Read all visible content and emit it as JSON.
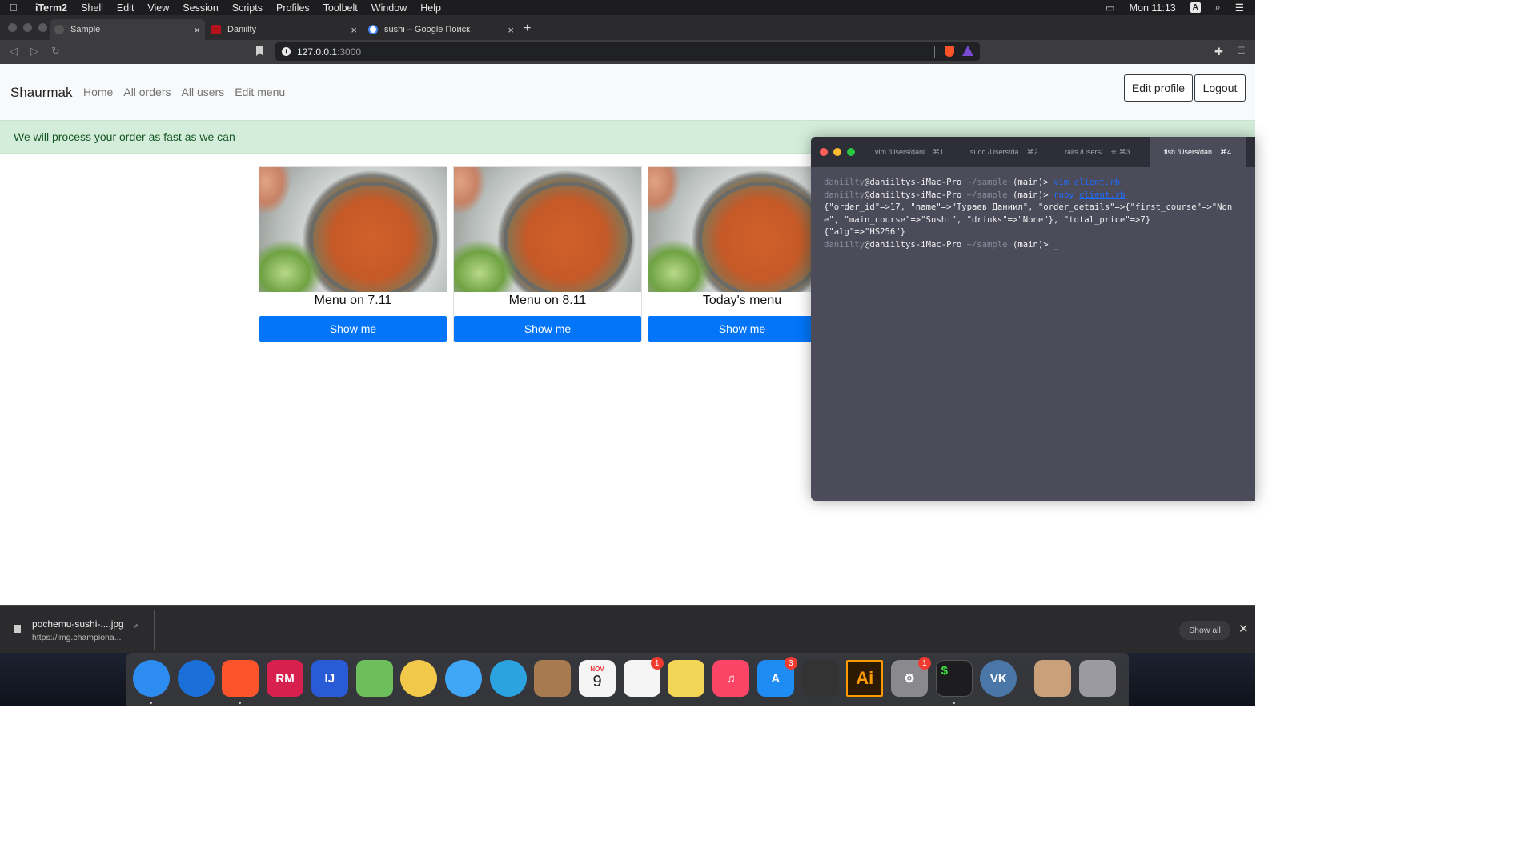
{
  "menubar": {
    "items": [
      "iTerm2",
      "Shell",
      "Edit",
      "View",
      "Session",
      "Scripts",
      "Profiles",
      "Toolbelt",
      "Window",
      "Help"
    ],
    "clock": "Mon 11:13",
    "input_source": "A"
  },
  "browser": {
    "tabs": [
      {
        "label": "Sample",
        "active": true
      },
      {
        "label": "Daniilty",
        "active": false
      },
      {
        "label": "sushi – Google Поиск",
        "active": false
      }
    ],
    "new_tab": "+",
    "url_host": "127.0.0.1",
    "url_port": ":3000",
    "info_glyph": "!"
  },
  "site": {
    "brand": "Shaurmak",
    "nav": [
      "Home",
      "All orders",
      "All users",
      "Edit menu"
    ],
    "edit_profile": "Edit profile",
    "logout": "Logout",
    "alert": "We will process your order as fast as we can",
    "cards": [
      {
        "title": "Menu on 7.11",
        "button": "Show me"
      },
      {
        "title": "Menu on 8.11",
        "button": "Show me"
      },
      {
        "title": "Today's menu",
        "button": "Show me"
      }
    ]
  },
  "terminal": {
    "tabs": [
      {
        "label": "vim /Users/dani...",
        "shortcut": "⌘1"
      },
      {
        "label": "sudo /Users/da...",
        "shortcut": "⌘2"
      },
      {
        "label": "rails /Users/...",
        "shortcut": "⌘3"
      },
      {
        "label": "fish /Users/dan...",
        "shortcut": "⌘4"
      }
    ],
    "user": "daniilty",
    "host": "@daniiltys-iMac-Pro",
    "cwd": "~/sample",
    "branch": "(main)>",
    "cmd1": "vim",
    "cmd1_arg": "client.rb",
    "cmd2": "ruby",
    "cmd2_arg": "client.rb",
    "out1": "{\"order_id\"=>17, \"name\"=>\"Тураев Даниил\", \"order_details\"=>{\"first_course\"=>\"Non",
    "out2": "e\", \"main_course\"=>\"Sushi\", \"drinks\"=>\"None\"}, \"total_price\"=>7}",
    "out3": "{\"alg\"=>\"HS256\"}",
    "cursor": "_"
  },
  "download": {
    "filename": "pochemu-sushi-....jpg",
    "url": "https://img.championa...",
    "show_all": "Show all",
    "close": "✕",
    "chevron": "^"
  },
  "dock": {
    "apps": [
      {
        "name": "finder",
        "label": "",
        "color": "#2d8cf0"
      },
      {
        "name": "safari",
        "label": "",
        "color": "#1b6fd8"
      },
      {
        "name": "brave",
        "label": "",
        "color": "#fb542b"
      },
      {
        "name": "rubymine",
        "label": "RM",
        "color": "#d8204f"
      },
      {
        "name": "intellij",
        "label": "IJ",
        "color": "#2a5bd7"
      },
      {
        "name": "maps",
        "label": "",
        "color": "#6cbf5a"
      },
      {
        "name": "photos",
        "label": "",
        "color": "#f2c84b"
      },
      {
        "name": "messages",
        "label": "",
        "color": "#3fa7f5"
      },
      {
        "name": "telegram",
        "label": "",
        "color": "#2aa3e0"
      },
      {
        "name": "contacts",
        "label": "",
        "color": "#a77b4f"
      },
      {
        "name": "calendar",
        "label": "9",
        "color": "#f5f5f5"
      },
      {
        "name": "reminders",
        "label": "",
        "color": "#f5f5f5"
      },
      {
        "name": "notes",
        "label": "",
        "color": "#f4d657"
      },
      {
        "name": "music",
        "label": "♫",
        "color": "#fa4566"
      },
      {
        "name": "app-store",
        "label": "A",
        "color": "#1e8cf3"
      },
      {
        "name": "final-cut",
        "label": "",
        "color": "#333"
      },
      {
        "name": "illustrator",
        "label": "Ai",
        "color": "#2d1a05"
      },
      {
        "name": "system-preferences",
        "label": "⚙",
        "color": "#8a8a8e"
      },
      {
        "name": "terminal",
        "label": "$",
        "color": "#1d1d1f"
      },
      {
        "name": "vk",
        "label": "VK",
        "color": "#4a76a8"
      },
      {
        "name": "sushi-image",
        "label": "",
        "color": "#c9a07a"
      },
      {
        "name": "trash",
        "label": "",
        "color": "#9a9aa0"
      }
    ],
    "badges": {
      "reminders": "1",
      "app-store": "3",
      "system-preferences": "1"
    },
    "calendar_month": "NOV"
  }
}
